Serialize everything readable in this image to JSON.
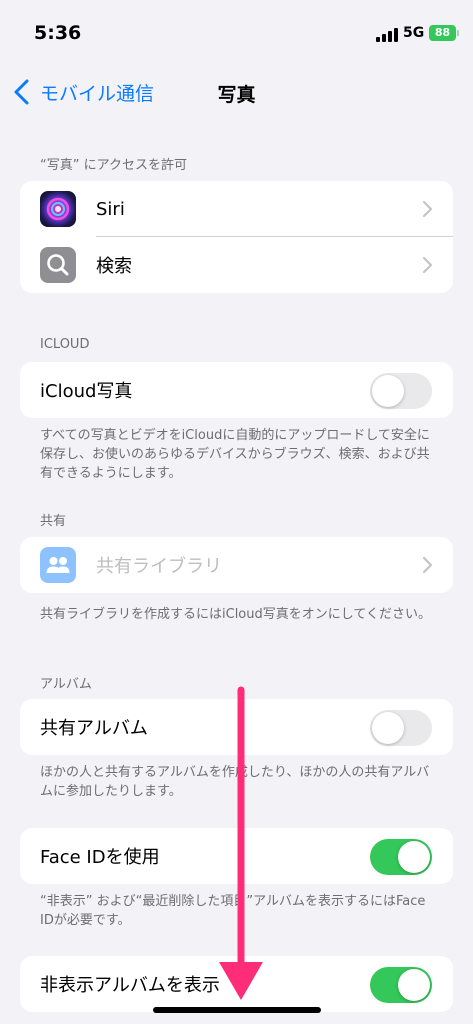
{
  "status": {
    "time": "5:36",
    "network": "5G",
    "battery": "88"
  },
  "nav": {
    "back_label": "モバイル通信",
    "title": "写真"
  },
  "sections": {
    "access": {
      "header": "“写真” にアクセスを許可",
      "items": [
        {
          "label": "Siri",
          "icon": "siri-icon"
        },
        {
          "label": "検索",
          "icon": "search-icon"
        }
      ]
    },
    "icloud": {
      "header": "ICLOUD",
      "label": "iCloud写真",
      "enabled": false,
      "footer": "すべての写真とビデオをiCloudに自動的にアップロードして安全に保存し、お使いのあらゆるデバイスからブラウズ、検索、および共有できるようにします。"
    },
    "shared": {
      "header": "共有",
      "label": "共有ライブラリ",
      "icon": "people-icon",
      "disabled": true,
      "footer": "共有ライブラリを作成するにはiCloud写真をオンにしてください。"
    },
    "albums": {
      "header": "アルバム",
      "label": "共有アルバム",
      "enabled": false,
      "footer": "ほかの人と共有するアルバムを作成したり、ほかの人の共有アルバムに参加したりします。"
    },
    "faceid": {
      "label": "Face IDを使用",
      "enabled": true,
      "footer": "“非表示” および“最近削除した項目”アルバムを表示するにはFace IDが必要です。"
    },
    "hidden": {
      "label": "非表示アルバムを表示",
      "enabled": true
    }
  },
  "colors": {
    "accent": "#0a7aff",
    "toggle_on": "#34c759",
    "annotation_arrow": "#ff2d78"
  }
}
